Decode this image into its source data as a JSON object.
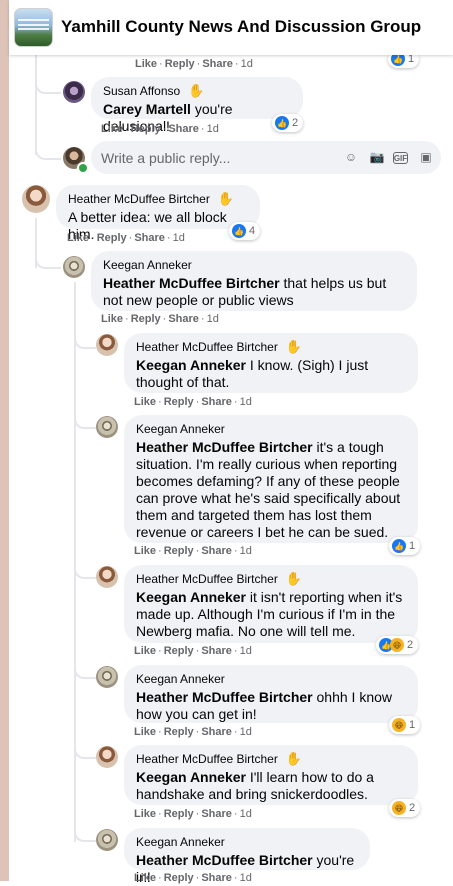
{
  "group": {
    "title": "Yamhill County News And Discussion Group"
  },
  "actions": {
    "like": "Like",
    "reply": "Reply",
    "share": "Share"
  },
  "reply_box": {
    "placeholder": "Write a public reply..."
  },
  "top_partial": {
    "time": "1d",
    "reaction_count": "1"
  },
  "comments": [
    {
      "author": "Susan Affonso",
      "mention": "Carey Martell",
      "text": " you're delusional!",
      "time": "1d",
      "reaction_count": "2",
      "reactions": [
        "like"
      ]
    },
    {
      "author": "Heather McDuffee Birtcher",
      "mention": "",
      "text": "A better idea: we all block him.",
      "time": "1d",
      "reaction_count": "4",
      "reactions": [
        "like"
      ]
    },
    {
      "author": "Keegan Anneker",
      "mention": "Heather McDuffee Birtcher",
      "text": " that helps us but not new people or public views",
      "time": "1d",
      "reaction_count": "",
      "reactions": []
    },
    {
      "author": "Heather McDuffee Birtcher",
      "mention": "Keegan Anneker",
      "text": " I know. (Sigh) I just thought of that.",
      "time": "1d",
      "reaction_count": "",
      "reactions": []
    },
    {
      "author": "Keegan Anneker",
      "mention": "Heather McDuffee Birtcher",
      "text": " it's a tough situation. I'm really curious when reporting becomes defaming? If any of these people can prove what he's said specifically about them and targeted them has lost them revenue or careers I bet he can be sued.",
      "time": "1d",
      "reaction_count": "1",
      "reactions": [
        "like"
      ]
    },
    {
      "author": "Heather McDuffee Birtcher",
      "mention": "Keegan Anneker",
      "text": " it isn't reporting when it's made up. Although I'm curious if I'm in the Newberg mafia. No one will tell me.",
      "time": "1d",
      "reaction_count": "2",
      "reactions": [
        "like",
        "haha"
      ]
    },
    {
      "author": "Keegan Anneker",
      "mention": "Heather McDuffee Birtcher",
      "text": " ohhh I know how you can get in!",
      "time": "1d",
      "reaction_count": "1",
      "reactions": [
        "haha"
      ]
    },
    {
      "author": "Heather McDuffee Birtcher",
      "mention": "Keegan Anneker",
      "text": " I'll learn how to do a handshake and bring snickerdoodles.",
      "time": "1d",
      "reaction_count": "2",
      "reactions": [
        "haha"
      ]
    },
    {
      "author": "Keegan Anneker",
      "mention": "Heather McDuffee Birtcher",
      "text": " you're in!",
      "time": "1d",
      "reaction_count": "",
      "reactions": []
    }
  ],
  "icons": {
    "wave": "✋",
    "like": "👍",
    "haha": "😆",
    "emoji": "☺",
    "camera": "📷",
    "gif": "GIF",
    "sticker": "▣"
  }
}
